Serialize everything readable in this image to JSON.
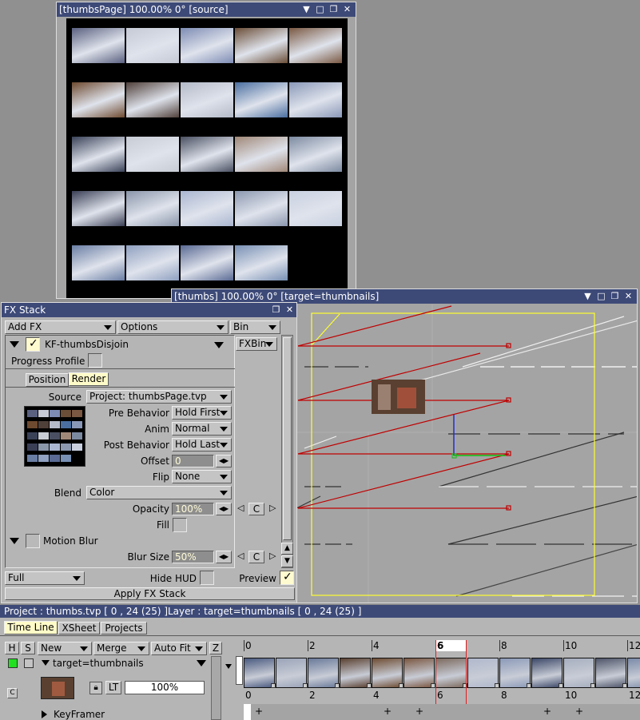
{
  "thumbs_window": {
    "title": "[thumbsPage]  100.00%   0°  [source]",
    "controls": [
      "▼",
      "□",
      "❐",
      "✕"
    ],
    "thumbnails": [
      "#5a6080",
      "#c6cad6",
      "#7e8cb4",
      "#6b4e38",
      "#7a5842",
      "#6e4a30",
      "#50403a",
      "#b4bac8",
      "#4a6ea0",
      "#8a98b8",
      "#3a4258",
      "#c8ccd4",
      "#4a5062",
      "#a08878",
      "#7c8aa0",
      "#3a3f55",
      "#8a96aa",
      "#aab6d0",
      "#8c98b0",
      "#c8d0e0",
      "#6a7ea4",
      "#8fa0c0",
      "#5a6a94",
      "#7890b4"
    ]
  },
  "viewer_window": {
    "title": "[thumbs]  100.00%   0°  [target=thumbnails]",
    "controls": [
      "▼",
      "□",
      "❐",
      "✕"
    ]
  },
  "fx_stack": {
    "title": "FX Stack",
    "controls": [
      "❐",
      "✕"
    ],
    "add_fx": "Add FX",
    "options": "Options",
    "bin": "Bin",
    "fxbin": "FXBin",
    "effect_name": "KF-thumbsDisjoin",
    "progress_profile": "Progress Profile",
    "tabs": [
      "Position",
      "Render"
    ],
    "source_label": "Source",
    "source_value": "Project: thumbsPage.tvp",
    "pre_behavior_label": "Pre Behavior",
    "pre_behavior_value": "Hold First",
    "anim_label": "Anim",
    "anim_value": "Normal",
    "post_behavior_label": "Post Behavior",
    "post_behavior_value": "Hold Last",
    "offset_label": "Offset",
    "offset_value": "0",
    "flip_label": "Flip",
    "flip_value": "None",
    "blend_label": "Blend",
    "blend_value": "Color",
    "opacity_label": "Opacity",
    "opacity_value": "100%",
    "fill_label": "Fill",
    "motion_blur_label": "Motion Blur",
    "blur_size_label": "Blur Size",
    "blur_size_value": "50%",
    "c_label": "C",
    "quality": "Full",
    "hide_hud": "Hide HUD",
    "preview": "Preview",
    "apply": "Apply FX Stack"
  },
  "status": {
    "project": "Project : thumbs.tvp [ 0 , 24  (25) ]",
    "layer": "Layer : target=thumbnails [ 0 , 24  (25) ]"
  },
  "timeline": {
    "tabs": [
      "Time Line",
      "XSheet",
      "Projects"
    ],
    "col_h": "H",
    "col_s": "S",
    "new_label": "New",
    "merge_label": "Merge",
    "autofit_label": "Auto Fit",
    "col_z": "Z",
    "layer_name": "target=thumbnails",
    "lt_label": "LT",
    "opacity_value": "100%",
    "keyframer_label": "KeyFramer",
    "c_badge": "C",
    "ruler_labels": [
      "0",
      "2",
      "4",
      "6",
      "8",
      "10",
      "12"
    ],
    "current_frame": "6",
    "frame_colors": [
      "#4a5a80",
      "#9aa4b8",
      "#6a7a9a",
      "#5a4030",
      "#6e4c32",
      "#7a5640",
      "#7c6a5e",
      "#b0b8cc",
      "#8c9ab8",
      "#3c4868",
      "#a6aebe",
      "#4e5468",
      "#7a8aa8"
    ]
  },
  "colors": {
    "title_bar": "#3d4a78",
    "panel_bg": "#b5b5b5",
    "viewer_bg": "#a4a4a4",
    "guide_yellow": "#ffff30",
    "anim_red": "#c00000",
    "tab_active": "#fffbc8"
  }
}
